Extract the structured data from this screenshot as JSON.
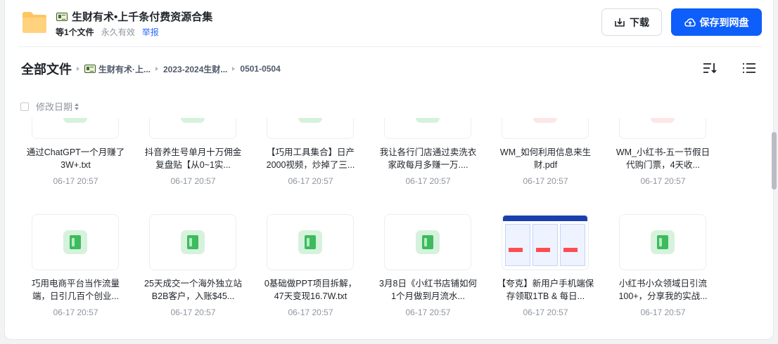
{
  "header": {
    "title": "生财有术•上千条付费资源合集",
    "count_text": "等1个文件",
    "validity_text": "永久有效",
    "report_label": "举报",
    "download_label": "下载",
    "save_label": "保存到网盘"
  },
  "breadcrumb": {
    "root": "全部文件",
    "items": [
      "生财有术·上...",
      "2023-2024生财...",
      "0501-0504"
    ]
  },
  "sort": {
    "label": "修改日期"
  },
  "files": [
    {
      "name": "通过ChatGPT一个月赚了3W+.txt",
      "date": "06-17 20:57",
      "icon": "txt-icon"
    },
    {
      "name": "抖音养生号单月十万佣金复盘贴【从0~1实...",
      "date": "06-17 20:57",
      "icon": "txt-icon"
    },
    {
      "name": "【巧用工具集合】日产2000视频，炒掉了三...",
      "date": "06-17 20:57",
      "icon": "txt-icon"
    },
    {
      "name": "我让各行门店通过卖洗衣家政每月多赚一万....",
      "date": "06-17 20:57",
      "icon": "txt-icon"
    },
    {
      "name": "WM_如何利用信息来生财.pdf",
      "date": "06-17 20:57",
      "icon": "pdf-icon"
    },
    {
      "name": "WM_小红书-五一节假日代购门票，4天收...",
      "date": "06-17 20:57",
      "icon": "pdf-icon"
    },
    {
      "name": "巧用电商平台当作流量端，日引几百个创业...",
      "date": "06-17 20:57",
      "icon": "txt-icon"
    },
    {
      "name": "25天成交一个海外独立站B2B客户，入账$45...",
      "date": "06-17 20:57",
      "icon": "txt-icon"
    },
    {
      "name": "0基础做PPT项目拆解，47天变现16.7W.txt",
      "date": "06-17 20:57",
      "icon": "txt-icon"
    },
    {
      "name": "3月8日《小红书店铺如何1个月做到月流水...",
      "date": "06-17 20:57",
      "icon": "txt-icon"
    },
    {
      "name": "【夸克】新用户手机端保存领取1TB & 每日...",
      "date": "06-17 20:57",
      "icon": "image-thumbnail"
    },
    {
      "name": "小红书小众领域日引流100+，分享我的实战...",
      "date": "06-17 20:57",
      "icon": "txt-icon"
    }
  ]
}
